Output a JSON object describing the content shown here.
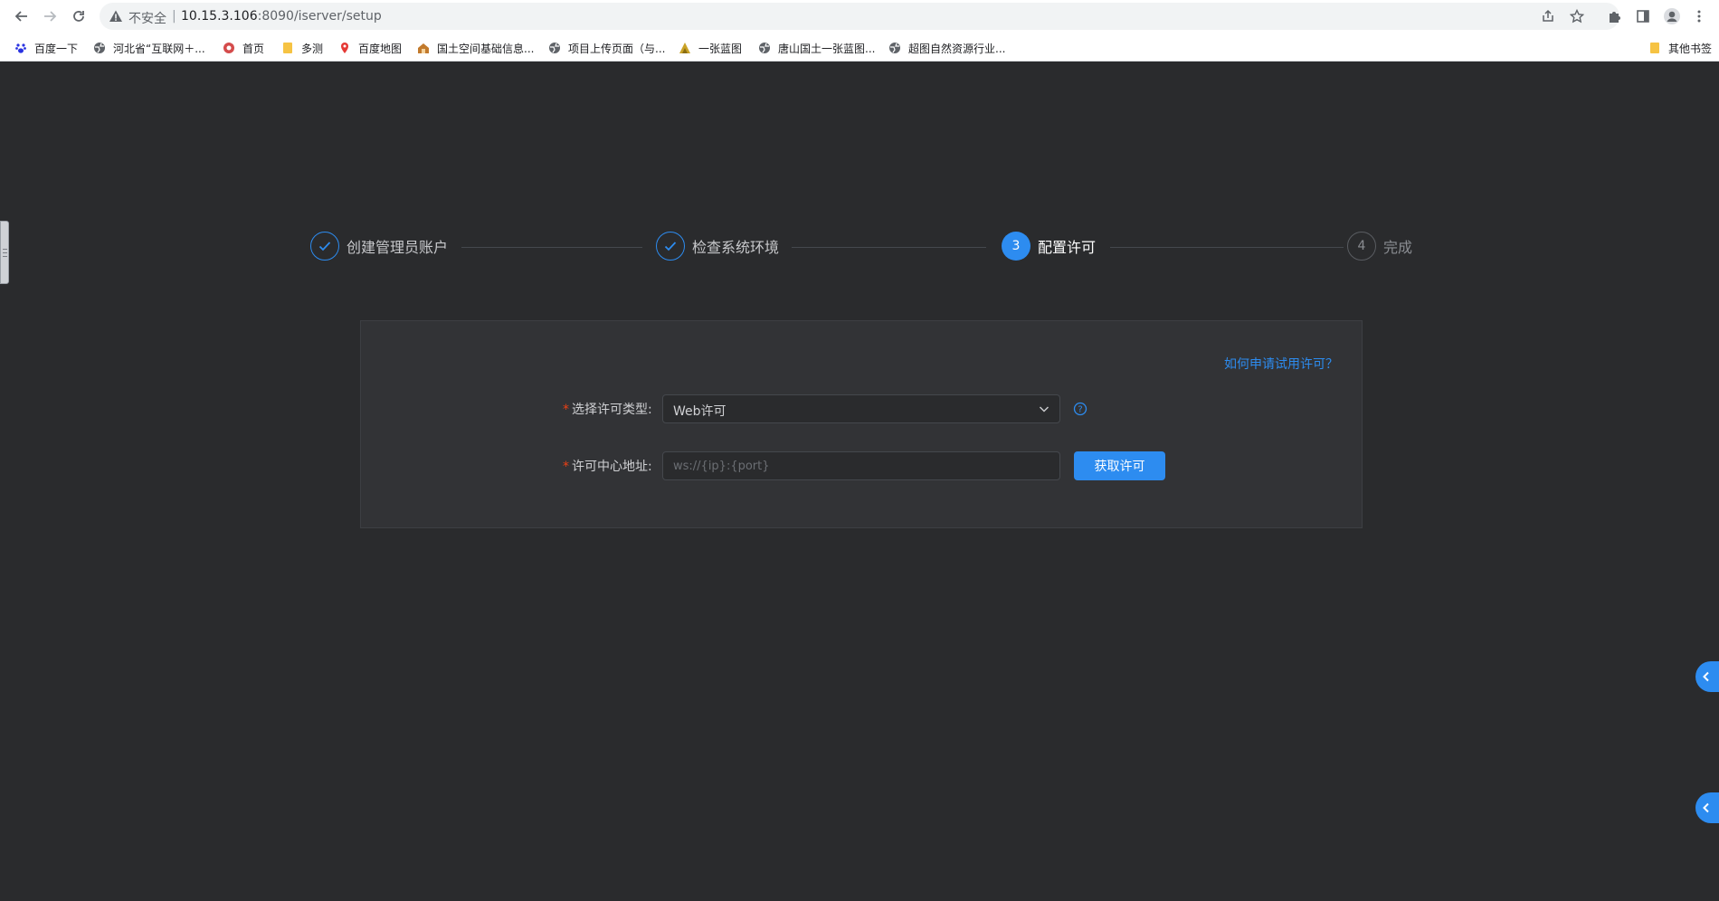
{
  "browser": {
    "insecure_label": "不安全",
    "address_separator": "|",
    "url_host": "10.15.3.106",
    "url_rest": ":8090/iserver/setup",
    "bookmarks": [
      {
        "label": "百度一下",
        "icon": "paw-icon"
      },
      {
        "label": "河北省“互联网＋...",
        "icon": "globe-icon"
      },
      {
        "label": "首页",
        "icon": "site-icon"
      },
      {
        "label": "多测",
        "icon": "folder-icon"
      },
      {
        "label": "百度地图",
        "icon": "map-pin-icon"
      },
      {
        "label": "国土空间基础信息...",
        "icon": "house-icon"
      },
      {
        "label": "项目上传页面（与...",
        "icon": "globe-icon"
      },
      {
        "label": "一张蓝图",
        "icon": "site-icon"
      },
      {
        "label": "唐山国土一张蓝图...",
        "icon": "globe-icon"
      },
      {
        "label": "超图自然资源行业...",
        "icon": "globe-icon"
      }
    ],
    "other_bookmarks": "其他书签"
  },
  "steps": [
    {
      "label": "创建管理员账户",
      "status": "done",
      "marker": "✓"
    },
    {
      "label": "检查系统环境",
      "status": "done",
      "marker": "✓"
    },
    {
      "label": "配置许可",
      "status": "active",
      "marker": "3"
    },
    {
      "label": "完成",
      "status": "wait",
      "marker": "4"
    }
  ],
  "form": {
    "help_link": "如何申请试用许可？",
    "required_mark": "*",
    "license_type_label": "选择许可类型:",
    "license_type_value": "Web许可",
    "license_center_label": "许可中心地址:",
    "license_center_placeholder": "ws://{ip}:{port}",
    "license_center_value": "",
    "get_license_button": "获取许可"
  },
  "colors": {
    "primary": "#2d8cf0",
    "background": "#2a2b2d",
    "panel": "#323336",
    "required": "#ed4014"
  }
}
